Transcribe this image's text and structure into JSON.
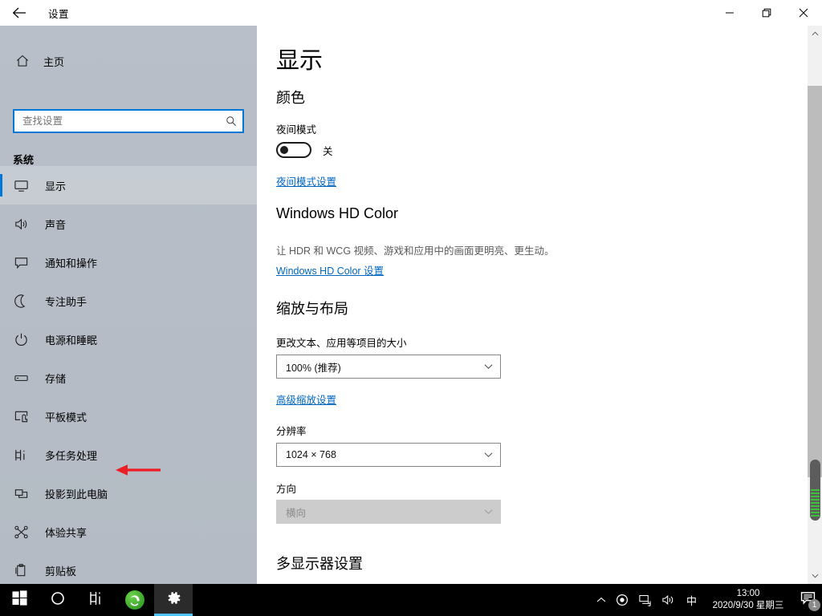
{
  "window": {
    "title": "设置",
    "back_icon": "back-arrow-icon",
    "controls": {
      "minimize": "—",
      "restore": "restore-icon",
      "close": "×"
    }
  },
  "sidebar": {
    "home": {
      "label": "主页",
      "icon": "home-icon"
    },
    "search": {
      "value": "",
      "placeholder": "查找设置",
      "icon": "search-icon"
    },
    "group_title": "系统",
    "items": [
      {
        "label": "显示",
        "icon": "monitor-icon",
        "selected": true
      },
      {
        "label": "声音",
        "icon": "speaker-icon",
        "selected": false
      },
      {
        "label": "通知和操作",
        "icon": "chat-bubble-icon",
        "selected": false
      },
      {
        "label": "专注助手",
        "icon": "moon-icon",
        "selected": false
      },
      {
        "label": "电源和睡眠",
        "icon": "power-icon",
        "selected": false
      },
      {
        "label": "存储",
        "icon": "drive-icon",
        "selected": false
      },
      {
        "label": "平板模式",
        "icon": "tablet-icon",
        "selected": false
      },
      {
        "label": "多任务处理",
        "icon": "multitask-icon",
        "selected": false
      },
      {
        "label": "投影到此电脑",
        "icon": "project-icon",
        "selected": false
      },
      {
        "label": "体验共享",
        "icon": "share-icon",
        "selected": false
      },
      {
        "label": "剪贴板",
        "icon": "clipboard-icon",
        "selected": false
      }
    ],
    "annotation": {
      "type": "red-arrow",
      "color": "#ee1c25",
      "points_to": "多任务处理"
    }
  },
  "content": {
    "page_title": "显示",
    "color_section": {
      "heading": "颜色",
      "night_light_label": "夜间模式",
      "night_light_state": "关",
      "night_light_on": false,
      "night_light_link": "夜间模式设置"
    },
    "hd_color_section": {
      "heading": "Windows HD Color",
      "description": "让 HDR 和 WCG 视频、游戏和应用中的画面更明亮、更生动。",
      "link": "Windows HD Color 设置"
    },
    "scale_section": {
      "heading": "缩放与布局",
      "scale_label": "更改文本、应用等项目的大小",
      "scale_value": "100% (推荐)",
      "advanced_link": "高级缩放设置",
      "resolution_label": "分辨率",
      "resolution_value": "1024 × 768",
      "orientation_label": "方向",
      "orientation_value": "横向",
      "orientation_disabled": true
    },
    "multi_display_heading": "多显示器设置"
  },
  "scrollbar": {
    "up_icon": "chevron-up-icon",
    "down_icon": "chevron-down-icon"
  },
  "taskbar": {
    "start": "start-icon",
    "search": "search-circle-icon",
    "taskview": "task-view-icon",
    "browser": "browser-icon",
    "settings": "gear-icon",
    "tray": {
      "overflow": "chevron-up-icon",
      "record": "record-icon",
      "network": "network-icon",
      "volume": "volume-icon",
      "ime": "中",
      "time": "13:00",
      "date": "2020/9/30 星期三",
      "notifications_icon": "notification-icon",
      "notifications_count": "1"
    }
  },
  "colors": {
    "accent": "#0078d7",
    "link": "#0067c0",
    "sidebar": "#b6bdc6",
    "annotation_red": "#ee1c25",
    "taskbar": "#000000"
  }
}
